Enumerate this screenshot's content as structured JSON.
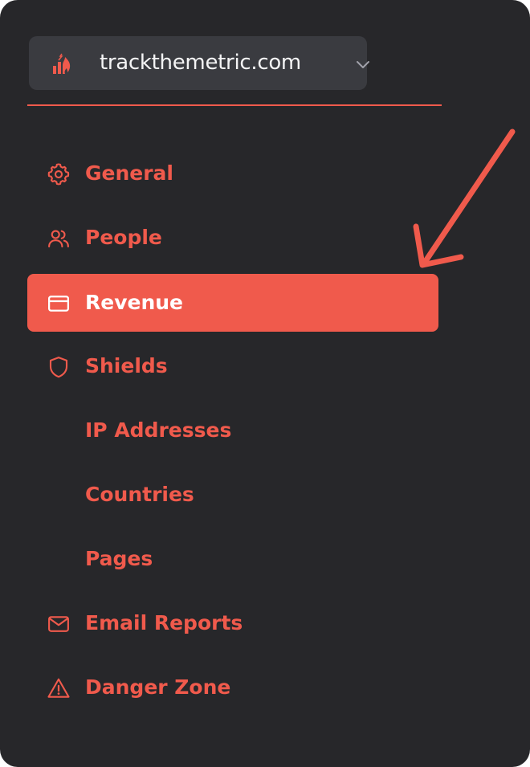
{
  "site_selector": {
    "site_name": "trackthemetric.com",
    "logo_icon": "fire-chart-icon",
    "dropdown_icon": "chevron-down-icon"
  },
  "nav": {
    "items": [
      {
        "label": "General",
        "icon": "gear-icon",
        "active": false
      },
      {
        "label": "People",
        "icon": "users-icon",
        "active": false
      },
      {
        "label": "Revenue",
        "icon": "credit-card-icon",
        "active": true
      },
      {
        "label": "Shields",
        "icon": "shield-icon",
        "active": false
      },
      {
        "label": "IP Addresses",
        "icon": "",
        "active": false
      },
      {
        "label": "Countries",
        "icon": "",
        "active": false
      },
      {
        "label": "Pages",
        "icon": "",
        "active": false
      },
      {
        "label": "Email Reports",
        "icon": "envelope-icon",
        "active": false
      },
      {
        "label": "Danger Zone",
        "icon": "warning-triangle-icon",
        "active": false
      }
    ]
  },
  "colors": {
    "background": "#27272a",
    "selector_bg": "#3a3b40",
    "accent": "#f05a4c",
    "active_text": "#ffffff",
    "site_text": "#f4f4f5"
  },
  "annotation": {
    "arrow_icon": "pointing-arrow-icon"
  }
}
